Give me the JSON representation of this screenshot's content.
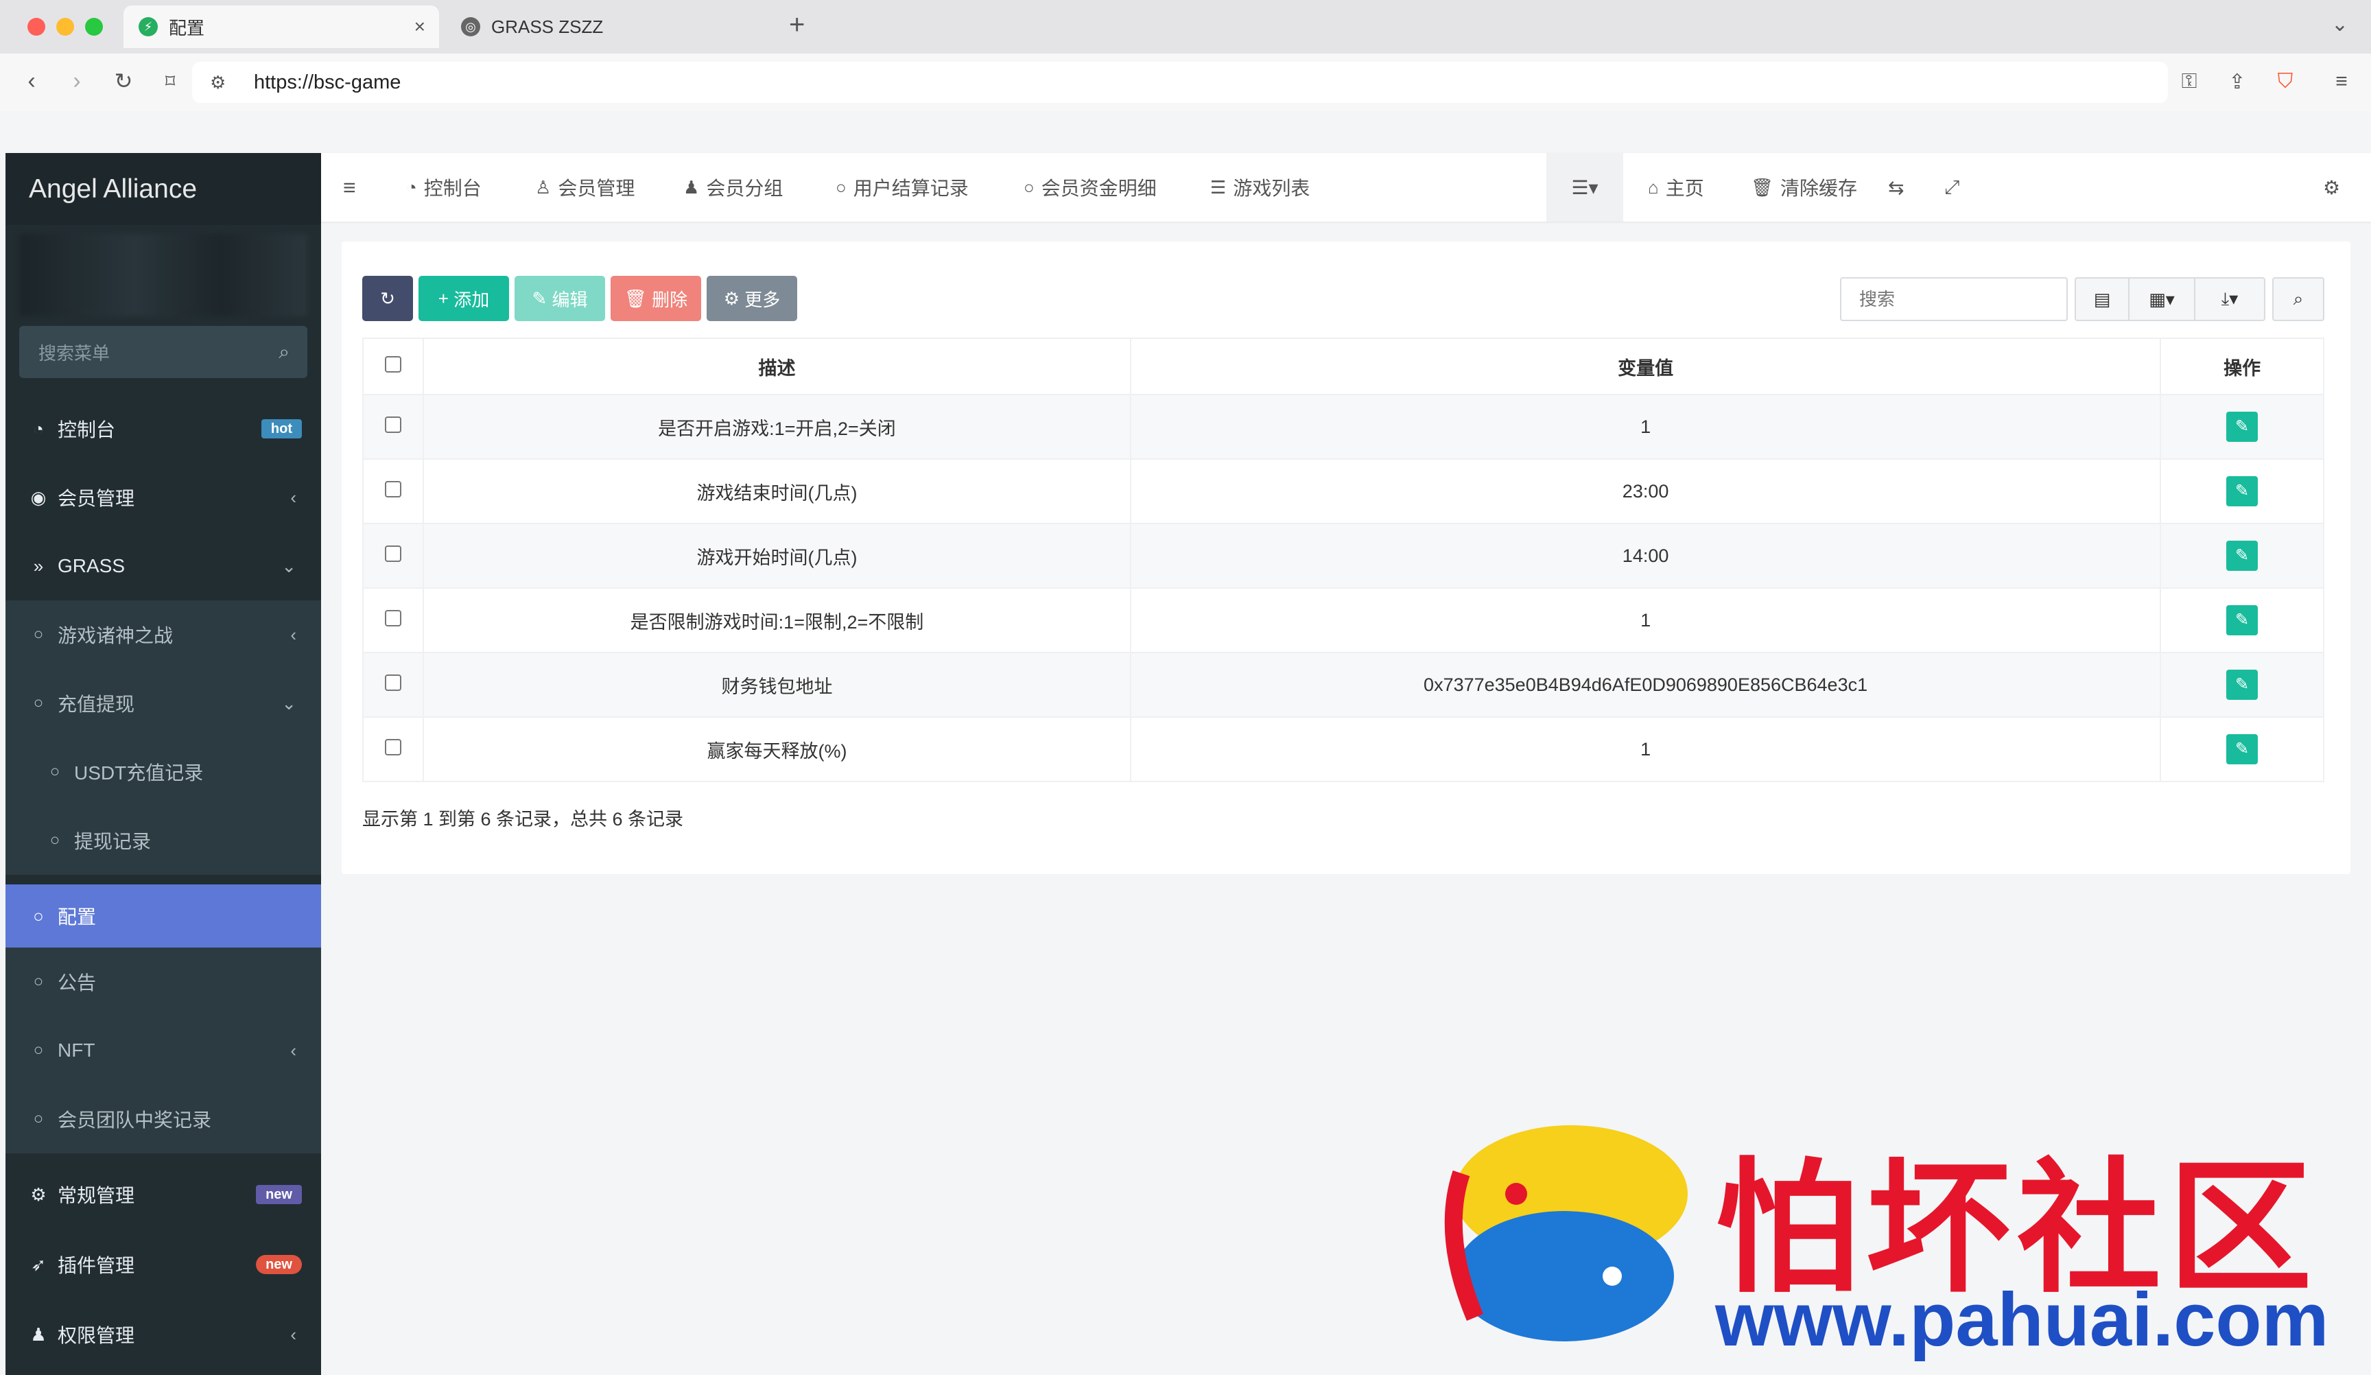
{
  "browser": {
    "tabs": [
      {
        "title": "配置",
        "active": true
      },
      {
        "title": "GRASS ZSZZ",
        "active": false
      }
    ],
    "url": "https://bsc-game"
  },
  "sidebar": {
    "brand": "Angel Alliance",
    "search_placeholder": "搜索菜单",
    "items": [
      {
        "label": "控制台",
        "icon": "dashboard-icon",
        "badge": "hot"
      },
      {
        "label": "会员管理",
        "icon": "user-circle-icon"
      },
      {
        "label": "GRASS",
        "icon": "double-chevron-icon"
      },
      {
        "label": "游戏诸神之战",
        "icon": "circle-icon"
      },
      {
        "label": "充值提现",
        "icon": "circle-icon"
      },
      {
        "label": "USDT充值记录",
        "icon": "circle-icon"
      },
      {
        "label": "提现记录",
        "icon": "circle-icon"
      },
      {
        "label": "配置",
        "icon": "circle-icon"
      },
      {
        "label": "公告",
        "icon": "circle-icon"
      },
      {
        "label": "NFT",
        "icon": "circle-icon"
      },
      {
        "label": "会员团队中奖记录",
        "icon": "circle-icon"
      },
      {
        "label": "常规管理",
        "icon": "cogs-icon",
        "badge": "new"
      },
      {
        "label": "插件管理",
        "icon": "rocket-icon",
        "badge": "new"
      },
      {
        "label": "权限管理",
        "icon": "group-icon"
      }
    ]
  },
  "topnav": {
    "tabs": [
      "控制台",
      "会员管理",
      "会员分组",
      "用户结算记录",
      "会员资金明细",
      "游戏列表"
    ],
    "right": [
      "主页",
      "清除缓存"
    ]
  },
  "toolbar": {
    "add": "添加",
    "edit": "编辑",
    "delete": "删除",
    "more": "更多",
    "search_placeholder": "搜索"
  },
  "table": {
    "headers": [
      "描述",
      "变量值",
      "操作"
    ],
    "rows": [
      {
        "desc": "是否开启游戏:1=开启,2=关闭",
        "value": "1"
      },
      {
        "desc": "游戏结束时间(几点)",
        "value": "23:00"
      },
      {
        "desc": "游戏开始时间(几点)",
        "value": "14:00"
      },
      {
        "desc": "是否限制游戏时间:1=限制,2=不限制",
        "value": "1"
      },
      {
        "desc": "财务钱包地址",
        "value": "0x7377e35e0B4B94d6AfE0D9069890E856CB64e3c1"
      },
      {
        "desc": "赢家每天释放(%)",
        "value": "1"
      }
    ],
    "footer": "显示第 1 到第 6 条记录，总共 6 条记录"
  },
  "watermark": {
    "text": "怕坏社区",
    "url": "www.pahuai.com"
  },
  "colors": {
    "sidebar_bg": "#222d32",
    "active_menu": "#5d78d6",
    "primary_dark": "#444c6b",
    "success": "#18bc9c",
    "danger": "#f0837b"
  }
}
